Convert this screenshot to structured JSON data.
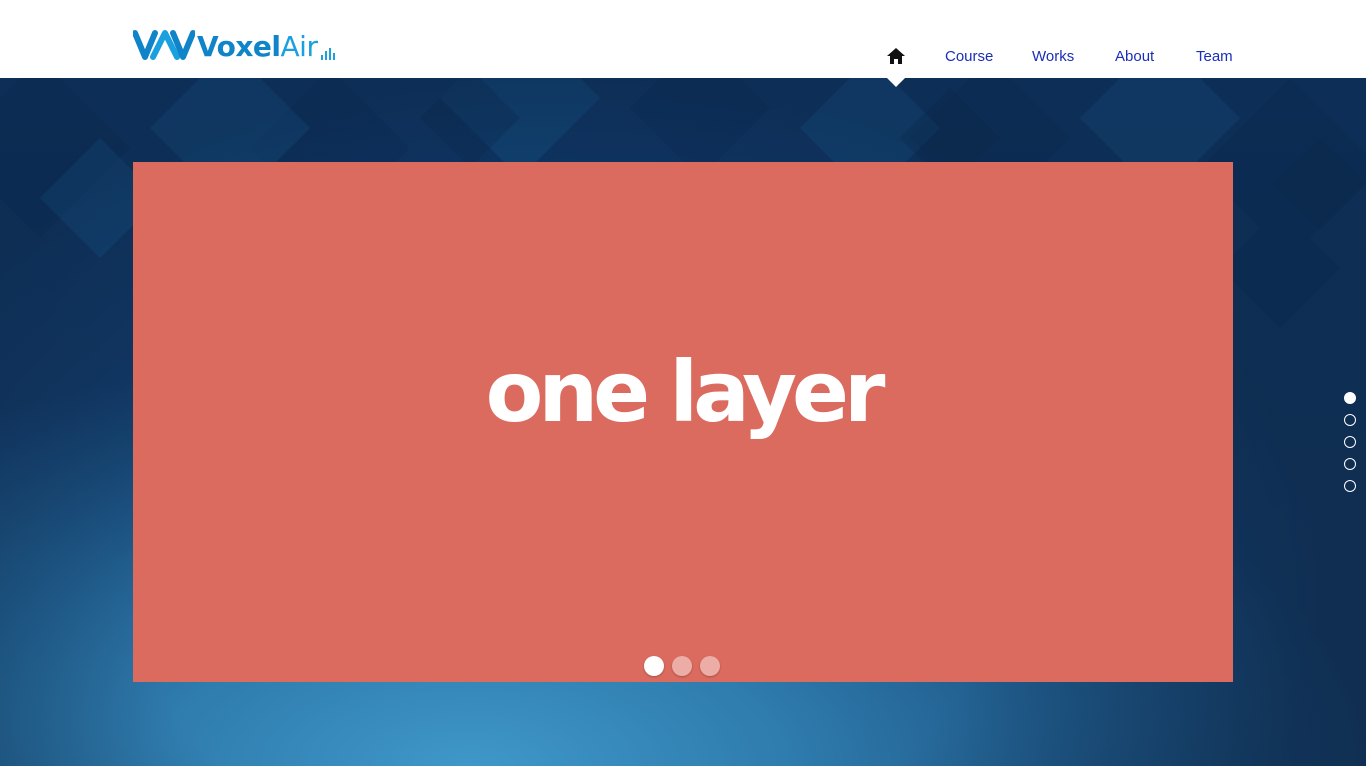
{
  "header": {
    "logo": {
      "word_bold": "Voxel",
      "word_light": "Air",
      "icon": "voxelair-logo-mark"
    },
    "nav": {
      "home_icon": "home-icon",
      "items": [
        {
          "label": "Course"
        },
        {
          "label": "Works"
        },
        {
          "label": "About"
        },
        {
          "label": "Team"
        }
      ],
      "link_color": "#1a2fb8"
    }
  },
  "hero": {
    "slider": {
      "slide_text": "one layer",
      "background_color": "#dc6b5f",
      "slide_count": 3,
      "active_slide": 1
    },
    "section_nav": {
      "section_count": 5,
      "active_section": 1
    }
  },
  "colors": {
    "brand": "#0f84c9",
    "hero_blue": "#1f5a8a",
    "slide": "#dc6b5f"
  }
}
